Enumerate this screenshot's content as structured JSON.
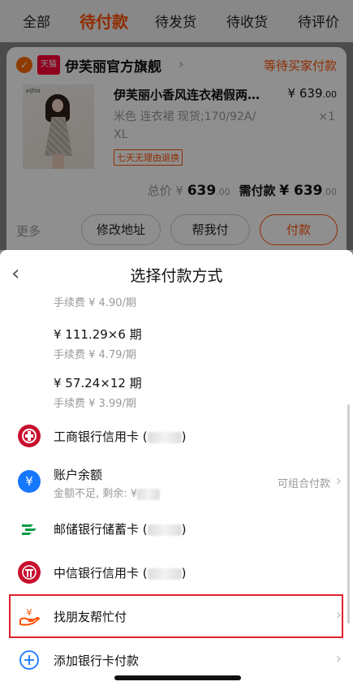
{
  "tabs": [
    {
      "label": "全部"
    },
    {
      "label": "待付款"
    },
    {
      "label": "待发货"
    },
    {
      "label": "待收货"
    },
    {
      "label": "待评价"
    }
  ],
  "order": {
    "tmall_badge": "天猫",
    "shop_name": "伊芙丽官方旗舰",
    "status": "等待买家付款",
    "thumb_brand": "eifini",
    "product_title": "伊芙丽小香风连衣裙假两…",
    "price_main": "¥ 639",
    "price_cents": ".00",
    "spec_line1": "米色 连衣裙 现货;170/92A/",
    "spec_line2": "XL",
    "quantity": "×1",
    "return_tag": "七天无理由退换",
    "total_label": "总价 ¥ ",
    "total_value": "639",
    "total_cents": ".00",
    "need_pay_label": "需付款",
    "need_pay_value": "¥ 639",
    "need_pay_cents": ".00",
    "more_label": "更多",
    "btn_modify_address": "修改地址",
    "btn_help_pay": "帮我付",
    "btn_pay": "付款"
  },
  "sheet": {
    "title": "选择付款方式",
    "partial_fee": "手续费 ¥ 4.90/期",
    "installments": [
      {
        "main": "¥ 111.29×6 期",
        "fee": "手续费 ¥ 4.79/期"
      },
      {
        "main": "¥ 57.24×12 期",
        "fee": "手续费 ¥ 3.99/期"
      }
    ],
    "methods": {
      "icbc": {
        "label": "工商银行信用卡 (",
        "suffix": ")"
      },
      "balance": {
        "label": "账户余额",
        "sub": "金额不足, 剩余: ¥",
        "right": "可组合付款"
      },
      "psbc": {
        "label": "邮储银行储蓄卡 (",
        "suffix": ")"
      },
      "citic": {
        "label": "中信银行信用卡 (",
        "suffix": ")"
      },
      "friend": {
        "label": "找朋友帮忙付"
      },
      "add_card": {
        "label": "添加银行卡付款"
      }
    }
  },
  "colors": {
    "accent": "#ff5000",
    "highlight": "#e2232a",
    "icbc": "#c8102e",
    "alipay_blue": "#1677ff",
    "psbc": "#009a44"
  }
}
